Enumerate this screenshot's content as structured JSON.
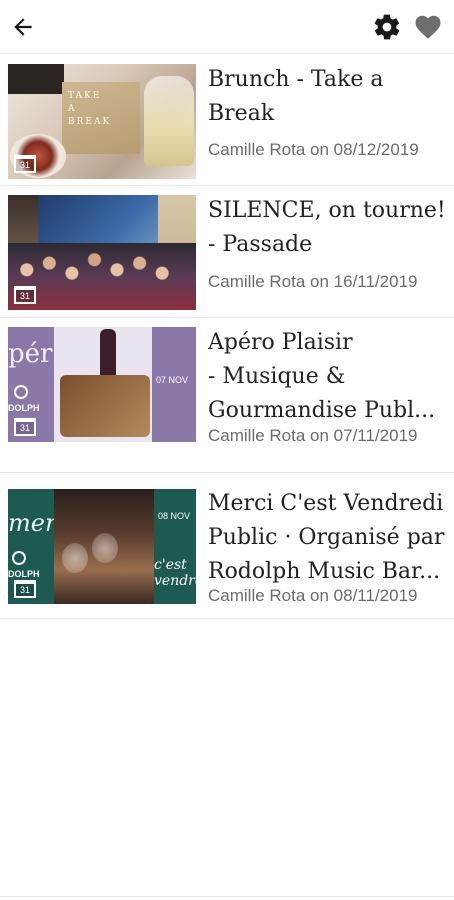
{
  "header": {
    "back_icon": "arrow-left-icon",
    "settings_icon": "gear-icon",
    "favorites_icon": "heart-icon",
    "icon_color": "#1a1a1a",
    "heart_color": "#6e6e6e"
  },
  "events": [
    {
      "title": "Brunch - Take a\nBreak",
      "meta": "Camille Rota on 08/12/2019",
      "thumb_text": "TAKE\nA\nBREAK"
    },
    {
      "title": "SILENCE, on tourne!\n- Passade",
      "meta": "Camille Rota on 16/11/2019"
    },
    {
      "title": "Apéro Plaisir\n- Musique &\nGourmandise Publ...",
      "meta": "Camille Rota on 07/11/2019",
      "thumb_word": "pér",
      "thumb_date": "07 NOV",
      "thumb_logo": "DOLPH"
    },
    {
      "title": "Merci C'est Vendredi\nPublic · Organisé par\nRodolph Music Bar...",
      "meta": "Camille Rota on 08/11/2019",
      "thumb_word": "merci",
      "thumb_date": "08 NOV",
      "thumb_cest": "c'est\nvendredi",
      "thumb_logo": "DOLPH"
    }
  ],
  "calendar_icon": "calendar-icon"
}
